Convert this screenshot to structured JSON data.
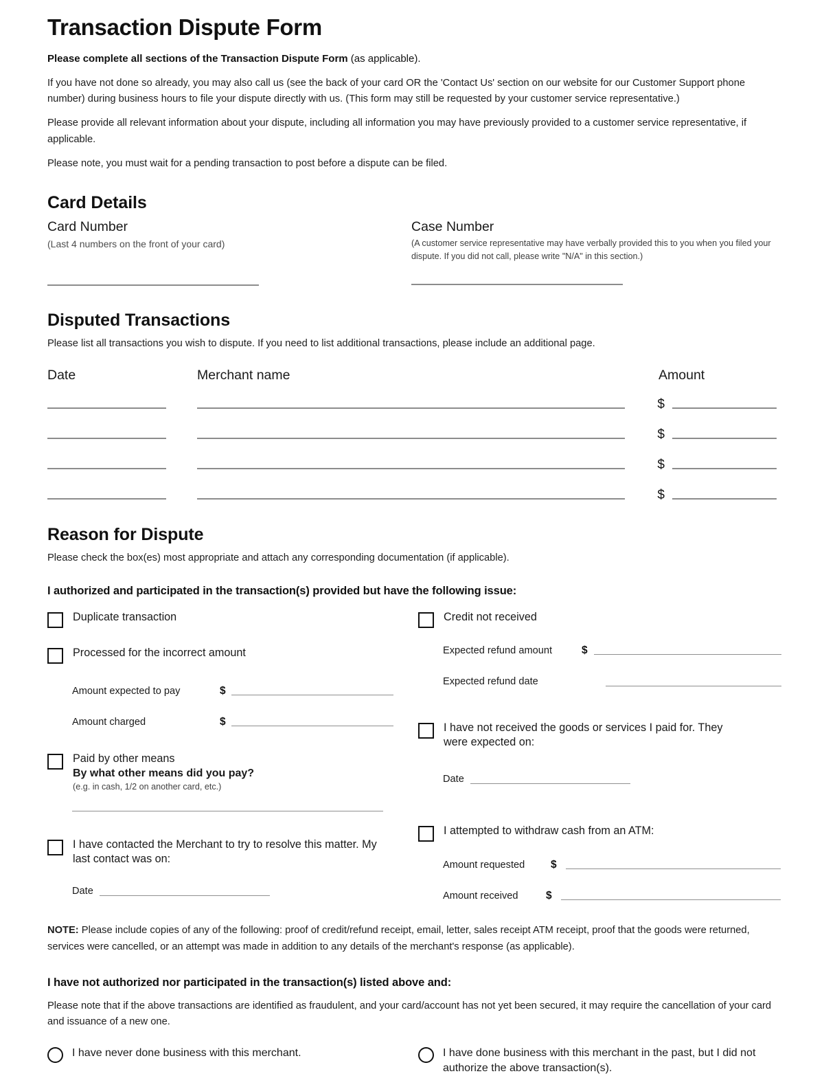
{
  "document": {
    "title": "Transaction Dispute Form",
    "intro": {
      "lead_bold": "Please complete all sections of the Transaction Dispute Form",
      "lead_rest": " (as applicable).",
      "paragraphs": [
        "If you have not done so already, you may also call us (see the back of your card OR the 'Contact Us' section on our website for our Customer Support phone number) during business hours to file your dispute directly with us. (This form may still be requested by your customer service representative.)",
        "Please provide all relevant information about your dispute, including all information you may have previously provided to a customer service representative, if applicable.",
        "Please note, you must wait for a pending transaction to post before a dispute can be filed."
      ]
    }
  },
  "card_details": {
    "heading": "Card Details",
    "card_number": {
      "label": "Card Number",
      "hint": "(Last 4 numbers on the front of your card)",
      "value": ""
    },
    "case_number": {
      "label": "Case Number",
      "hint": "(A customer service representative may have verbally provided this to you when you filed your dispute. If you did not call, please write \"N/A\" in this section.)",
      "value": ""
    }
  },
  "disputed_transactions": {
    "heading": "Disputed Transactions",
    "instruction": "Please list all transactions you wish to dispute. If you need to list additional transactions, please include an additional page.",
    "columns": [
      "Date",
      "Merchant name",
      "Amount"
    ],
    "currency_symbol": "$",
    "rows": [
      {
        "date": "",
        "merchant": "",
        "amount": ""
      },
      {
        "date": "",
        "merchant": "",
        "amount": ""
      },
      {
        "date": "",
        "merchant": "",
        "amount": ""
      },
      {
        "date": "",
        "merchant": "",
        "amount": ""
      }
    ]
  },
  "reason_for_dispute": {
    "heading": "Reason for Dispute",
    "instruction": "Please check the box(es) most appropriate and attach any corresponding documentation (if applicable).",
    "authorized_heading": "I authorized and participated in the transaction(s) provided but have the following issue:",
    "left_column": {
      "duplicate": {
        "label": "Duplicate transaction",
        "checked": false
      },
      "incorrect_amount": {
        "label": "Processed for the incorrect amount",
        "checked": false,
        "fields": [
          {
            "label": "Amount expected to pay",
            "currency": "$",
            "value": ""
          },
          {
            "label": "Amount charged",
            "currency": "$",
            "value": ""
          }
        ]
      },
      "paid_other_means": {
        "label": "Paid by other means",
        "checked": false,
        "question": "By what other means did you pay?",
        "hint": "(e.g. in cash, 1/2 on another card, etc.)",
        "value": ""
      },
      "contacted_merchant": {
        "label": "I have contacted the Merchant to try to resolve this matter. My last contact was on:",
        "checked": false,
        "date_label": "Date",
        "date_value": ""
      }
    },
    "right_column": {
      "credit_not_received": {
        "label": "Credit not received",
        "checked": false,
        "fields": [
          {
            "label": "Expected refund amount",
            "currency": "$",
            "value": ""
          },
          {
            "label": "Expected refund date",
            "currency": "",
            "value": ""
          }
        ]
      },
      "goods_not_received": {
        "label": "I have not received the goods or services I paid for. They were expected on:",
        "checked": false,
        "date_label": "Date",
        "date_value": ""
      },
      "atm_withdrawal": {
        "label": "I attempted to withdraw cash from an ATM:",
        "checked": false,
        "fields": [
          {
            "label": "Amount requested",
            "currency": "$",
            "value": ""
          },
          {
            "label": "Amount received",
            "currency": "$",
            "value": ""
          }
        ]
      }
    },
    "note": {
      "prefix": "NOTE:",
      "text": " Please include copies of any of the following: proof of credit/refund receipt, email, letter, sales receipt ATM receipt, proof that the goods were returned, services were cancelled, or an attempt was made in addition to any details of the merchant's response (as applicable)."
    }
  },
  "not_authorized": {
    "heading": "I have not authorized nor participated in the transaction(s) listed above and:",
    "note": "Please note that if the above transactions are identified as fraudulent, and your card/account has not yet been secured, it may require the cancellation of your card and issuance of a new one.",
    "options": [
      {
        "label": "I have never done business with this merchant.",
        "selected": false
      },
      {
        "label": "I have done business with this merchant in the past, but I did not authorize the above transaction(s).",
        "selected": false
      }
    ]
  },
  "colors": {
    "text": "#1a1a1a",
    "rule": "#8c8c8c",
    "hint": "#4d4d4d"
  }
}
